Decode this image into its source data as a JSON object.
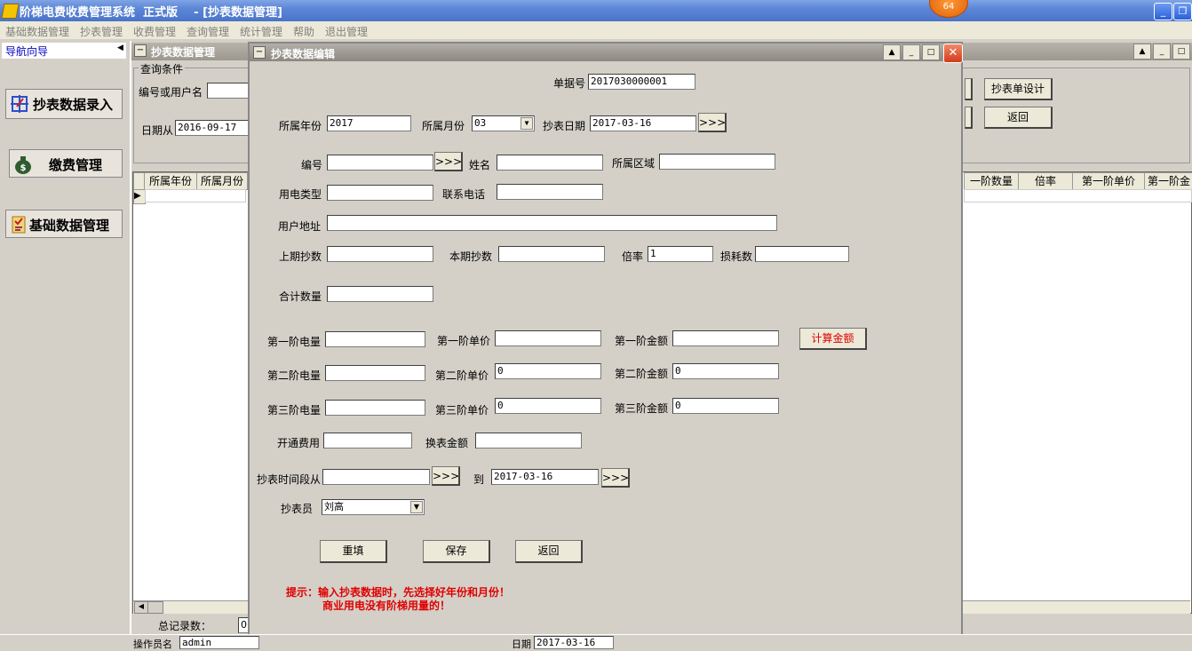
{
  "window": {
    "title": "阶梯电费收费管理系统  正式版    - [抄表数据管理]",
    "badge": "64"
  },
  "menu": [
    "基础数据管理",
    "抄表管理",
    "收费管理",
    "查询管理",
    "统计管理",
    "帮助",
    "退出管理"
  ],
  "nav": {
    "title": "导航向导",
    "items": [
      "抄表数据录入",
      "缴费管理",
      "基础数据管理"
    ]
  },
  "main": {
    "title": "抄表数据管理",
    "query_group": "查询条件",
    "query_label": "编号或用户名",
    "date_from_label": "日期从",
    "date_from": "2016-09-17",
    "btn_design": "抄表单设计",
    "btn_back": "返回",
    "grid_headers_left": [
      "所属年份",
      "所属月份"
    ],
    "grid_headers_right": [
      "一阶数量",
      "倍率",
      "第一阶单价",
      "第一阶金"
    ],
    "total_label": "总记录数：",
    "total_value": "0"
  },
  "dialog": {
    "title": "抄表数据编辑",
    "bill_no_label": "单据号",
    "bill_no": "2017030000001",
    "year_label": "所属年份",
    "year": "2017",
    "month_label": "所属月份",
    "month": "03",
    "read_date_label": "抄表日期",
    "read_date": "2017-03-16",
    "more": ">>>",
    "id_label": "编号",
    "name_label": "姓名",
    "area_label": "所属区域",
    "type_label": "用电类型",
    "phone_label": "联系电话",
    "address_label": "用户地址",
    "prev_label": "上期抄数",
    "curr_label": "本期抄数",
    "rate_label": "倍率",
    "rate": "1",
    "loss_label": "损耗数",
    "total_qty_label": "合计数量",
    "t1_qty_label": "第一阶电量",
    "t1_price_label": "第一阶单价",
    "t1_amt_label": "第一阶金额",
    "calc_button": "计算金额",
    "t2_qty_label": "第二阶电量",
    "t2_price_label": "第二阶单价",
    "t2_price": "0",
    "t2_amt_label": "第二阶金额",
    "t2_amt": "0",
    "t3_qty_label": "第三阶电量",
    "t3_price_label": "第三阶单价",
    "t3_price": "0",
    "t3_amt_label": "第三阶金额",
    "t3_amt": "0",
    "open_fee_label": "开通费用",
    "change_fee_label": "换表金额",
    "period_label": "抄表时间段从",
    "to_label": "到",
    "period_to": "2017-03-16",
    "reader_label": "抄表员",
    "reader": "刘高",
    "reset_button": "重填",
    "save_button": "保存",
    "back_button": "返回",
    "hint1": "提示：输入抄表数据时，先选择好年份和月份！",
    "hint2": "商业用电没有阶梯用量的！"
  },
  "status": {
    "operator_label": "操作员名",
    "operator": "admin",
    "date_label": "日期",
    "date": "2017-03-16"
  }
}
